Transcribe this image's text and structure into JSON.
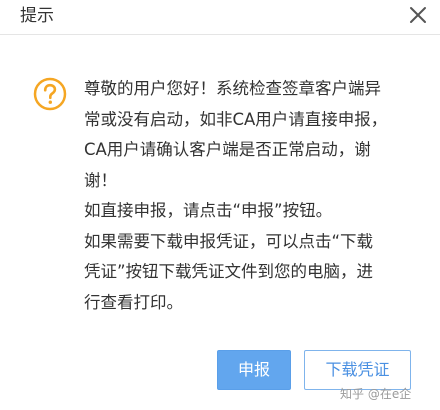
{
  "dialog": {
    "title": "提示",
    "close_icon": "close-icon",
    "question_icon": "question-circle-icon",
    "accent_color": "#f5a623",
    "message": {
      "line1": "尊敬的用户您好！系统检查签章客户端异",
      "line2": "常或没有启动，如非CA用户请直接申报，",
      "line3": "CA用户请确认客户端是否正常启动，谢",
      "line4": "谢！",
      "line5": "如直接申报，请点击“申报”按钮。",
      "line6": "如果需要下载申报凭证，可以点击“下载",
      "line7": "凭证”按钮下载凭证文件到您的电脑，进",
      "line8": "行查看打印。"
    },
    "buttons": {
      "declare_label": "申报",
      "download_label": "下载凭证",
      "primary_color": "#62a6ee"
    }
  },
  "watermark": "知乎 @在e企"
}
